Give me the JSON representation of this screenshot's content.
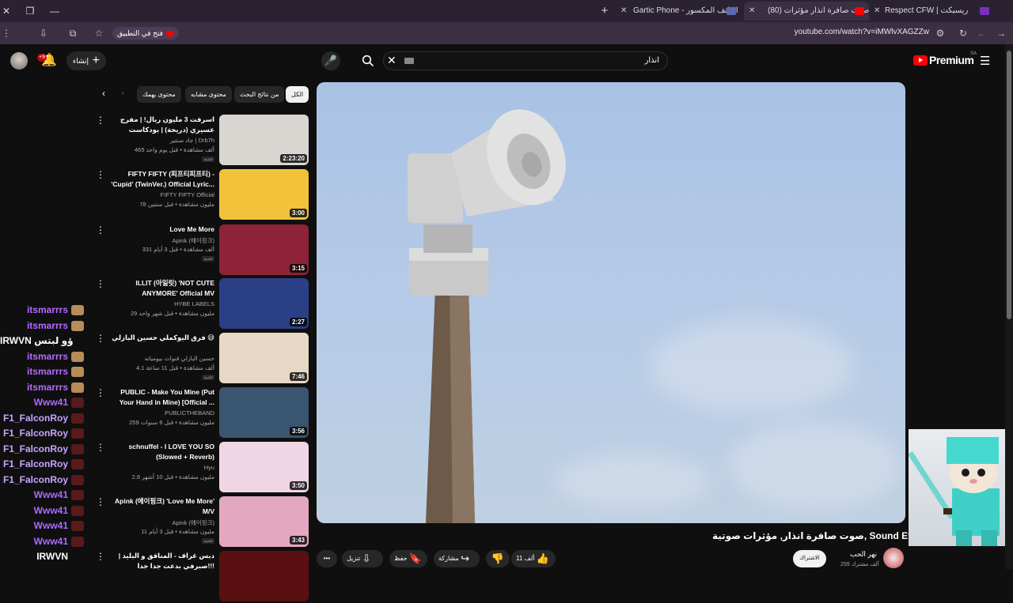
{
  "browser": {
    "window_controls": {
      "close": "✕",
      "restore": "❐",
      "minimize": "—"
    },
    "new_tab": "+",
    "tabs": [
      {
        "title": "Gartic Phone - الهاتف المكسور",
        "active": false
      },
      {
        "title": "(80) صوت صافرة انذار مؤثرات",
        "active": true
      },
      {
        "title": "Respect CFW | ريسبكت",
        "active": false
      }
    ],
    "url": "youtube.com/watch?v=iMWlvXAGZZw",
    "open_in_app": "فتح في التطبيق"
  },
  "masthead": {
    "logo_text": "Premium",
    "logo_region": "SA",
    "search_query": "انذار",
    "create_label": "إنشاء",
    "notif_count": "+9"
  },
  "chips": [
    {
      "label": "الكل",
      "selected": true
    },
    {
      "label": "من نتائج البحث",
      "selected": false
    },
    {
      "label": "محتوى مشابه",
      "selected": false
    },
    {
      "label": "محتوى يهمك",
      "selected": false
    }
  ],
  "video": {
    "title": "صوت صافرة انذار, مؤثرات صوتية, Sound Effects",
    "channel": "نهر الحب",
    "subs": "259 ألف مشترك",
    "subscribe_label": "الاشتراك",
    "likes": "11 ألف",
    "share": "مشاركة",
    "save": "حفظ",
    "download": "تنزيل",
    "more": "•••"
  },
  "recs": [
    {
      "title": "اسرقت 3 مليون ريال! | مفرج عسيري (دريحة) | بودكاست يسري خير",
      "channel": "جاد سنتير | Drb7h",
      "meta": "465 ألف مشاهدة • قبل يوم واحد",
      "dur": "2:23:20",
      "new": "جديد",
      "thumb": "#d9d6d1"
    },
    {
      "title": "FIFTY FIFTY (피프티피프티) - 'Cupid' (TwinVer.) Official Lyric...",
      "channel": "FIFTY FIFTY Official",
      "meta": "78 مليون مشاهدة • قبل سنتين",
      "dur": "3:00",
      "new": "",
      "thumb": "#f2c23a"
    },
    {
      "title": "Love Me More",
      "channel": "Apink (에이핑크)",
      "meta": "331 ألف مشاهدة • قبل 3 أيام",
      "dur": "3:15",
      "new": "جديد",
      "thumb": "#8e2236"
    },
    {
      "title": "ILLIT (아일릿) 'NOT CUTE ANYMORE' Official MV",
      "channel": "HYBE LABELS",
      "meta": "29 مليون مشاهدة • قبل شهر واحد",
      "dur": "2:27",
      "new": "",
      "thumb": "#2b3f86"
    },
    {
      "title": "فرق اليوكملي حسين البازلي 😅",
      "channel": "حسين البازلي قنوات بيومياته",
      "meta": "4.1 ألف مشاهدة • قبل 11 ساعة",
      "dur": "7:46",
      "new": "جديد",
      "thumb": "#e7d8c5"
    },
    {
      "title": "PUBLIC - Make You Mine (Put Your Hand in Mine) [Official ...",
      "channel": "PUBLICTHEBAND",
      "meta": "259 مليون مشاهدة • قبل 6 سنوات",
      "dur": "3:56",
      "new": "",
      "thumb": "#3a5570"
    },
    {
      "title": "schnuffel - I LOVE YOU SO (Slowed + Reverb)",
      "channel": "Hyu",
      "meta": "2.8 مليون مشاهدة • قبل 10 أشهر",
      "dur": "3:50",
      "new": "",
      "thumb": "#f0d5e4"
    },
    {
      "title": "Apink (에이핑크) 'Love Me More' M/V",
      "channel": "Apink (에이핑크)",
      "meta": "11 مليون مشاهدة • قبل 3 أيام",
      "dur": "3:43",
      "new": "جديد",
      "thumb": "#e3a7c0"
    },
    {
      "title": "دبس غراف - المناقق و البليد | صبرفي بدعت جدا جدا!!!",
      "channel": "",
      "meta": "",
      "dur": "",
      "new": "",
      "thumb": "#5a1010"
    }
  ],
  "chat": [
    {
      "name": "itsmarrrs",
      "color": "#b26bff",
      "emote": "#b88b5a"
    },
    {
      "name": "itsmarrrs",
      "color": "#b26bff",
      "emote": "#b88b5a"
    },
    {
      "name": "IRWVN ؤو لبتس",
      "color": "#ffffff",
      "emote": ""
    },
    {
      "name": "itsmarrrs",
      "color": "#b26bff",
      "emote": "#b88b5a"
    },
    {
      "name": "itsmarrrs",
      "color": "#b26bff",
      "emote": "#b88b5a"
    },
    {
      "name": "itsmarrrs",
      "color": "#b26bff",
      "emote": "#b88b5a"
    },
    {
      "name": "Www41",
      "color": "#a96bff",
      "emote": "#5a1a1a"
    },
    {
      "name": "F1_FalconRoy",
      "color": "#c6a6ff",
      "emote": "#5a1a1a"
    },
    {
      "name": "F1_FalconRoy",
      "color": "#c6a6ff",
      "emote": "#5a1a1a"
    },
    {
      "name": "F1_FalconRoy",
      "color": "#c6a6ff",
      "emote": "#5a1a1a"
    },
    {
      "name": "F1_FalconRoy",
      "color": "#c6a6ff",
      "emote": "#5a1a1a"
    },
    {
      "name": "F1_FalconRoy",
      "color": "#c6a6ff",
      "emote": "#5a1a1a"
    },
    {
      "name": "Www41",
      "color": "#a96bff",
      "emote": "#5a1a1a"
    },
    {
      "name": "Www41",
      "color": "#a96bff",
      "emote": "#5a1a1a"
    },
    {
      "name": "Www41",
      "color": "#a96bff",
      "emote": "#5a1a1a"
    },
    {
      "name": "Www41",
      "color": "#a96bff",
      "emote": "#5a1a1a"
    },
    {
      "name": "IRWVN",
      "color": "#ffffff",
      "emote": ""
    }
  ]
}
